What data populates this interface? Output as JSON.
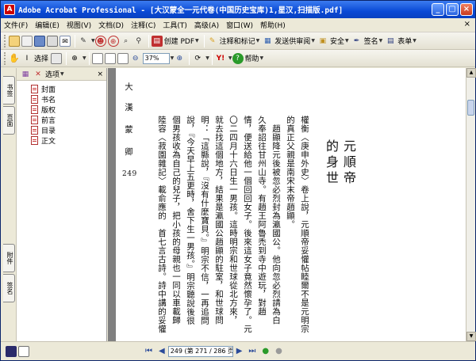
{
  "window": {
    "title": "Adobe Acrobat Professional - [大汉蒙全一元代卷(中国历史宝库)1,星汉,扫描版.pdf]",
    "app_icon": "acrobat-icon"
  },
  "menubar": {
    "items": [
      "文件(F)",
      "编辑(E)",
      "视图(V)",
      "文档(D)",
      "注释(C)",
      "工具(T)",
      "高级(A)",
      "窗口(W)",
      "帮助(H)"
    ]
  },
  "toolbar1": {
    "create_pdf": "创建 PDF",
    "comment_markup": "注释和标记",
    "send_review": "发送供审阅",
    "secure": "安全",
    "sign": "签名",
    "forms": "表单"
  },
  "toolbar2": {
    "select": "选择",
    "zoom": "37%",
    "help": "帮助"
  },
  "left_tabs": {
    "bookmarks": "书签",
    "pages": "页面",
    "attachments": "附件",
    "signatures": "签名"
  },
  "bookmarks": {
    "options": "选项",
    "items": [
      "封面",
      "书名",
      "版权",
      "前言",
      "目录",
      "正文"
    ]
  },
  "page_content": {
    "header_char1": "大",
    "header_char2": "漢",
    "header_char3": "蒙",
    "header_char4": "卿",
    "page_no": "249",
    "chapter_title1": "元順帝",
    "chapter_title2": "的身世",
    "lines": [
      "權衡〈庚申外史〉卷上說，元順帝妥懽帖睦爾不是元明宗",
      "的真正父親是南宋末帝趙顯。",
      "　趙顯降元後被忽必烈封為瀛國公。他向忽必烈請為白",
      "久奉詔往甘州山寺。有趙王阿魯禿到寺中遊玩，對趙",
      "情，便送給他一個回回女子。後來這女子竟然懷孕了。元",
      "〇二四月十六日生一男孩。這時明宗和世球從北方來，",
      "就去找這個地方，結果是瀛國公趙顯的駐室，和世球問",
      "明：「這縣說，『沒有什麼寶貝。』明宗不信，一再追問",
      "說，『今天早上五更時，舍下生一男孩。』明宗聽說後很",
      "個男孩收為自己的兒子，把小孩的母親也一同以車載歸",
      "陸容〈菽園雜記〉載俞應的　首七言古詩。詩中講的妥懽"
    ]
  },
  "statusbar": {
    "page": "249 (第 271 / 286 页)"
  },
  "colors": {
    "titlebar": "#0a4ad6",
    "chrome": "#ece9d8",
    "page_bg": "#808080"
  }
}
